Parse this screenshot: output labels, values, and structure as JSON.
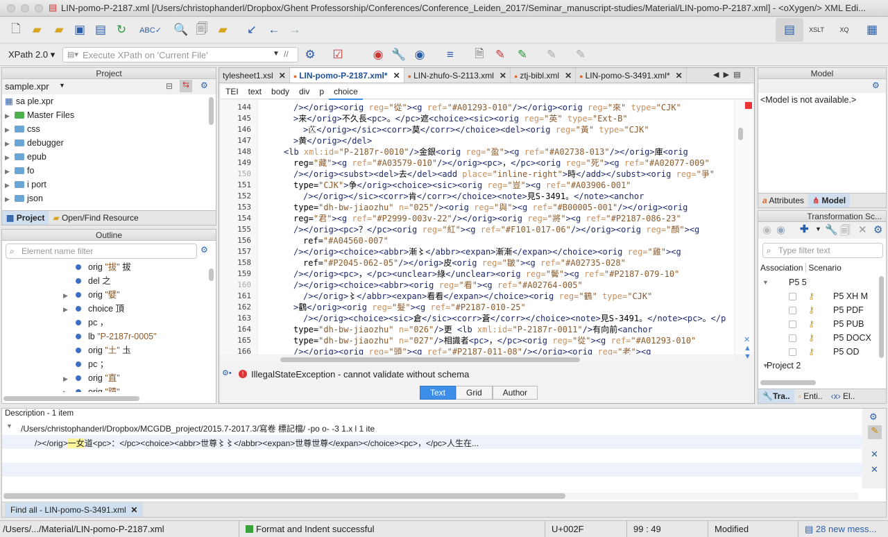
{
  "window": {
    "title": "LIN-pomo-P-2187.xml [/Users/christophanderl/Dropbox/Ghent Professorship/Conferences/Conference_Leiden_2017/Seminar_manuscript-studies/Material/LIN-pomo-P-2187.xml] - <oXygen/> XML Edi..."
  },
  "toolbar2": {
    "xpath_version": "XPath 2.0",
    "xpath_placeholder": "Execute XPath on  'Current File'"
  },
  "project": {
    "header": "Project",
    "file": "sample.xpr",
    "items": [
      {
        "label": "sa   ple.xpr",
        "kind": "file"
      },
      {
        "label": "Master Files",
        "kind": "folder-green"
      },
      {
        "label": "css",
        "kind": "folder"
      },
      {
        "label": "debugger",
        "kind": "folder"
      },
      {
        "label": "epub",
        "kind": "folder"
      },
      {
        "label": "fo",
        "kind": "folder"
      },
      {
        "label": "i   port",
        "kind": "folder"
      },
      {
        "label": "json",
        "kind": "folder"
      }
    ],
    "tabs": [
      "Project",
      "Open/Find Resource"
    ]
  },
  "outline": {
    "header": "Outline",
    "filter_placeholder": "Element name filter",
    "items": [
      {
        "name": "orig",
        "q": "\"拔\"",
        "text": "拔",
        "fold": false
      },
      {
        "name": "del",
        "q": "",
        "text": "之",
        "fold": false
      },
      {
        "name": "orig",
        "q": "\"嬖\"",
        "text": "",
        "fold": true
      },
      {
        "name": "choice",
        "q": "",
        "text": "頂",
        "fold": true
      },
      {
        "name": "pc",
        "q": "",
        "text": "，",
        "fold": false
      },
      {
        "name": "lb",
        "q": "\"P-2187r-0005\"",
        "text": "",
        "fold": false
      },
      {
        "name": "orig",
        "q": "\"土\"",
        "text": "圡",
        "fold": false
      },
      {
        "name": "pc",
        "q": "",
        "text": "；",
        "fold": false
      },
      {
        "name": "orig",
        "q": "\"直\"",
        "text": "",
        "fold": true
      },
      {
        "name": "orig",
        "q": "\"蹟\"",
        "text": "",
        "fold": true
      }
    ]
  },
  "editor": {
    "tabs": [
      {
        "label": "tylesheet1.xsl",
        "active": false,
        "modified": false
      },
      {
        "label": "LIN-pomo-P-2187.xml*",
        "active": true,
        "modified": true
      },
      {
        "label": "LIN-zhufo-S-2113.xml",
        "active": false,
        "modified": true
      },
      {
        "label": "ztj-bibl.xml",
        "active": false,
        "modified": true
      },
      {
        "label": "LIN-pomo-S-3491.xml*",
        "active": false,
        "modified": true
      }
    ],
    "breadcrumb": [
      "TEI",
      "text",
      "body",
      "div",
      "p",
      "choice"
    ],
    "lines": [
      {
        "n": "144",
        "indent": 7,
        "code": "/></orig><orig reg=\"從\"><g ref=\"#A01293-010\"/></orig><orig reg=\"來\" type=\"CJK\""
      },
      {
        "n": "145",
        "indent": 7,
        "code": ">来</orig>不久長<pc>。</pc>遮<choice><sic><orig reg=\"英\" type=\"Ext-B\""
      },
      {
        "n": "146",
        "indent": 9,
        "code": ">𦬆</orig></sic><corr>莫</corr></choice><del><orig reg=\"黃\" type=\"CJK\""
      },
      {
        "n": "147",
        "indent": 7,
        "code": ">黄</orig></del>"
      },
      {
        "n": "148",
        "indent": 5,
        "code": "<lb xml:id=\"P-2187r-0010\"/>金銀<orig reg=\"盈\"><g ref=\"#A02738-013\"/></orig>庫<orig"
      },
      {
        "n": "149",
        "indent": 7,
        "code": "reg=\"藏\"><g ref=\"#A03579-010\"/></orig><pc>，</pc><orig reg=\"死\"><g ref=\"#A02077-009\""
      },
      {
        "n": "150",
        "indent": 7,
        "code": "/></orig><subst><del>去</del><add place=\"inline-right\">時</add></subst><orig reg=\"爭\""
      },
      {
        "n": "151",
        "indent": 7,
        "code": "type=\"CJK\">争</orig><choice><sic><orig reg=\"豈\"><g ref=\"#A03906-001\""
      },
      {
        "n": "152",
        "indent": 9,
        "code": "/></orig></sic><corr>肯</corr></choice><note>見S-3491。</note><anchor"
      },
      {
        "n": "153",
        "indent": 7,
        "code": "type=\"dh-bw-jiaozhu\" n=\"025\"/><orig reg=\"與\"><g ref=\"#B00005-001\"/></orig><orig"
      },
      {
        "n": "154",
        "indent": 7,
        "code": "reg=\"君\"><g ref=\"#P2999-003v-22\"/></orig><orig reg=\"將\"><g ref=\"#P2187-086-23\""
      },
      {
        "n": "155",
        "indent": 7,
        "code": "/></orig><pc>？</pc><orig reg=\"紅\"><g ref=\"#F101-017-06\"/></orig><orig reg=\"顏\"><g"
      },
      {
        "n": "156",
        "indent": 9,
        "code": "ref=\"#A04560-007\""
      },
      {
        "n": "157",
        "indent": 7,
        "code": "/></orig><choice><abbr>漸〻</abbr><expan>漸漸</expan></choice><orig reg=\"雞\"><g"
      },
      {
        "n": "158",
        "indent": 9,
        "code": "ref=\"#P2045-062-05\"/></orig>皮<orig reg=\"皺\"><g ref=\"#A02735-028\""
      },
      {
        "n": "159",
        "indent": 7,
        "code": "/></orig><pc>，</pc><unclear>綠</unclear><orig reg=\"鬢\"><g ref=\"#P2187-079-10\""
      },
      {
        "n": "160",
        "indent": 7,
        "code": "/></orig><choice><abbr><orig reg=\"看\"><g ref=\"#A02764-005\""
      },
      {
        "n": "161",
        "indent": 9,
        "code": "/></orig>〻</abbr><expan>看看</expan></choice><orig reg=\"鶴\" type=\"CJK\""
      },
      {
        "n": "162",
        "indent": 7,
        "code": ">鸖</orig><orig reg=\"髮\"><g ref=\"#P2187-010-25\""
      },
      {
        "n": "163",
        "indent": 9,
        "code": "/></orig><choice><sic>倉</sic><corr>蒼</corr></choice><note>見S-3491。</note><pc>。</p"
      },
      {
        "n": "164",
        "indent": 7,
        "code": "type=\"dh-bw-jiaozhu\" n=\"026\"/>更 <lb xml:id=\"P-2187r-0011\"/>有向前<anchor"
      },
      {
        "n": "165",
        "indent": 7,
        "code": "type=\"dh-bw-jiaozhu\" n=\"027\"/>相識者<pc>，</pc><orig reg=\"從\"><g ref=\"#A01293-010\""
      },
      {
        "n": "166",
        "indent": 7,
        "code": "/></orig><orig reg=\"頭\"><g ref=\"#P2187-011-08\"/></orig><orig reg=\"老\"><g"
      }
    ],
    "error": "IllegalStateException - cannot validate without schema",
    "modes": [
      "Text",
      "Grid",
      "Author"
    ],
    "active_mode": "Text"
  },
  "model": {
    "header": "Model",
    "message": "<Model is not available.>",
    "tabs": [
      "Attributes",
      "Model"
    ]
  },
  "transform": {
    "header": "Transformation Sc...",
    "filter_placeholder": "Type filter text",
    "columns": [
      "Association",
      "Scenario"
    ],
    "group1": "P5   5",
    "scenarios": [
      "P5  XH   M",
      "P5  PDF",
      "P5    PUB",
      "P5  DOCX",
      "P5  OD"
    ],
    "group2": "Project   2",
    "tabs": [
      "Tra..",
      "Enti..",
      "El.."
    ]
  },
  "results": {
    "header": "Description - 1 item",
    "path": "/Users/christophanderl/Dropbox/MCGDB_project/2015.7-2017.3/寫卷    標記檔/    -po   o-  -3    1.x   l  1 ite",
    "match_before": "/></orig>",
    "match": "一女",
    "match_after": "道<pc>：</pc><choice><abbr>世尊〻〻</abbr><expan>世尊世尊</expan></choice><pc>，</pc>人生在...",
    "tab": "Find all - LIN-pomo-S-3491.xml"
  },
  "status": {
    "path": "/Users/.../Material/LIN-pomo-P-2187.xml",
    "message": "Format and Indent successful",
    "char": "U+002F",
    "position": "99 : 49",
    "state": "Modified",
    "messages": "28 new mess..."
  },
  "colors": {
    "tag": "#1e2a6b",
    "attr_name": "#c89060",
    "attr_value": "#8b5a2b",
    "accent": "#3d8ee8",
    "highlight": "#fff59a"
  }
}
